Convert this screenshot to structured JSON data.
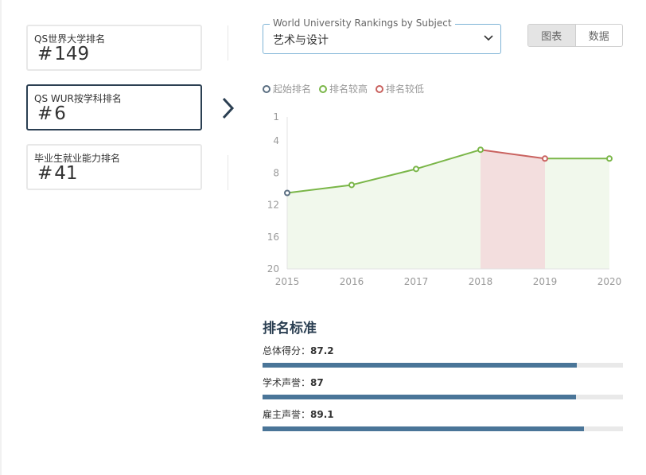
{
  "rank_cards": [
    {
      "label": "QS世界大学排名",
      "hash": "#",
      "value": "149",
      "active": false
    },
    {
      "label": "QS WUR按学科排名",
      "hash": "#",
      "value": "6",
      "active": true
    },
    {
      "label": "毕业生就业能力排名",
      "hash": "#",
      "value": "41",
      "active": false
    }
  ],
  "subject_select": {
    "legend": "World University Rankings by Subject",
    "value": "艺术与设计"
  },
  "view_toggle": {
    "chart_label": "图表",
    "data_label": "数据",
    "selected": "chart"
  },
  "legend": [
    {
      "label": "起始排名",
      "color": "#5b6f82"
    },
    {
      "label": "排名较高",
      "color": "#7ab648"
    },
    {
      "label": "排名较低",
      "color": "#c9625f"
    }
  ],
  "chart_data": {
    "type": "line",
    "title": "",
    "xlabel": "",
    "ylabel": "",
    "categories": [
      "2015",
      "2016",
      "2017",
      "2018",
      "2019",
      "2020"
    ],
    "series": [
      {
        "values": [
          10.5,
          9.5,
          7.5,
          5.1,
          6.2,
          6.2
        ]
      }
    ],
    "point_status": [
      "start",
      "higher",
      "higher",
      "higher",
      "lower",
      "higher"
    ],
    "y_inverted": true,
    "ylim": [
      1,
      20
    ],
    "y_ticks": [
      1,
      4,
      8,
      12,
      16,
      20
    ],
    "colors": {
      "start": "#5b6f82",
      "higher": "#7ab648",
      "lower": "#c9625f",
      "higher_fill": "#f1f8ec",
      "lower_fill": "#f3dede"
    }
  },
  "criteria": {
    "title": "排名标准",
    "items": [
      {
        "label": "总体得分：",
        "score": "87.2",
        "fraction": 0.872
      },
      {
        "label": "学术声誉：",
        "score": "87",
        "fraction": 0.87
      },
      {
        "label": "雇主声誉：",
        "score": "89.1",
        "fraction": 0.891
      }
    ]
  }
}
